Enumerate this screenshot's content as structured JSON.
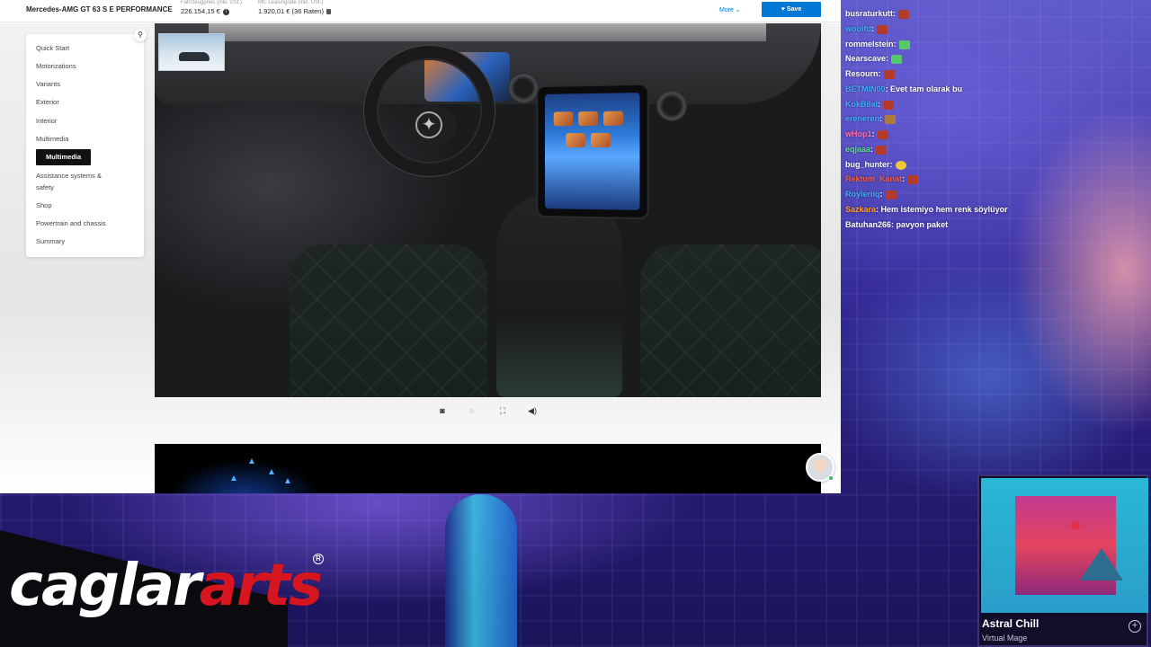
{
  "header": {
    "model_name": "Mercedes-AMG GT 63 S E PERFORMANCE",
    "price_label": "Fahrzeugpreis (inkl. USt.)",
    "price_value": "226.154,15 €",
    "leasing_label": "Mtl. Leasingrate (inkl. USt.)",
    "leasing_value": "1.920,01 € (36 Raten)",
    "more_label": "More",
    "save_label": "Save"
  },
  "menu": {
    "items": [
      {
        "label": "Quick Start"
      },
      {
        "label": "Motorizations"
      },
      {
        "label": "Variants"
      },
      {
        "label": "Exterior"
      },
      {
        "label": "Interior"
      },
      {
        "label": "Multimedia"
      },
      {
        "label": "Multimedia",
        "active": true
      },
      {
        "label": "Assistance systems &"
      },
      {
        "label": "safety"
      },
      {
        "label": "Shop"
      },
      {
        "label": "Powertrain and chassis"
      },
      {
        "label": "Summary"
      }
    ]
  },
  "viewer": {
    "controls": [
      "camera-icon",
      "rotate-icon",
      "fullscreen-icon",
      "sound-icon"
    ]
  },
  "chat": {
    "messages": [
      {
        "user": "busraturkutt",
        "sep": ":",
        "text": "",
        "color": "#ffffff",
        "emote_color": "#b43a2a"
      },
      {
        "user": "woolfd",
        "sep": ":",
        "text": "",
        "color": "#3bb0ff",
        "emote_color": "#b43a2a"
      },
      {
        "user": "rommelstein",
        "sep": ":",
        "text": "",
        "color": "#ffffff",
        "emote_color": "#56c96b"
      },
      {
        "user": "Nearscave",
        "sep": ":",
        "text": "",
        "color": "#ffffff",
        "emote_color": "#56c96b"
      },
      {
        "user": "Resourn",
        "sep": ":",
        "text": "",
        "color": "#ffffff",
        "emote_color": "#b43a2a"
      },
      {
        "user": "BETMIN00",
        "sep": ":",
        "text": "Evet tam olarak bu",
        "color": "#3bb0ff",
        "emote_color": ""
      },
      {
        "user": "KokBilal",
        "sep": ":",
        "text": "",
        "color": "#3bb0ff",
        "emote_color": "#b43a2a"
      },
      {
        "user": "ereneren",
        "sep": ":",
        "text": "",
        "color": "#3bb0ff",
        "emote_color": "#b07a3a"
      },
      {
        "user": "wHop1",
        "sep": ":",
        "text": "",
        "color": "#ff6fb4",
        "emote_color": "#b43a2a"
      },
      {
        "user": "eqjaaa",
        "sep": ":",
        "text": "",
        "color": "#56e08a",
        "emote_color": "#b43a2a"
      },
      {
        "user": "bug_hunter",
        "sep": ":",
        "text": "",
        "color": "#ffffff",
        "emote_color": "#f2c73a"
      },
      {
        "user": "Rektum_Kanat",
        "sep": ":",
        "text": "",
        "color": "#ff5a3c",
        "emote_color": "#b43a2a"
      },
      {
        "user": "Royleriiq",
        "sep": ":",
        "text": "",
        "color": "#3bb0ff",
        "emote_color": "#b43a2a"
      },
      {
        "user": "Sazkara",
        "sep": ":",
        "text": "Hem istemiyo hem renk söylüyor",
        "color": "#ff9f2a",
        "emote_color": ""
      },
      {
        "user": "Batuhan266",
        "sep": ":",
        "text": "pavyon paket",
        "color": "#ffffff",
        "emote_color": ""
      }
    ]
  },
  "logo": {
    "part1": "caglar",
    "part2": "arts",
    "reg": "R"
  },
  "now_playing": {
    "title": "Astral Chill",
    "artist": "Virtual Mage"
  }
}
